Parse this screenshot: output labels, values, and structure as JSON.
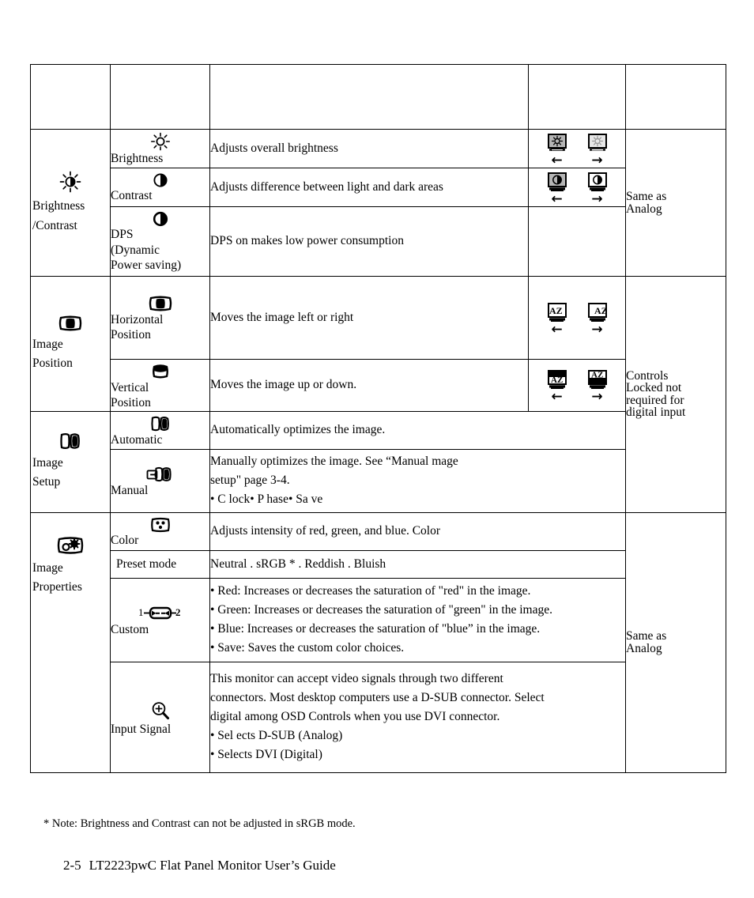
{
  "document": {
    "note": "* Note: Brightness and Contrast can not be adjusted in sRGB mode.",
    "footer_page": "2-5",
    "footer_title": "LT2223pwC Flat Panel Monitor User’s Guide"
  },
  "table": {
    "header_row": {
      "c1": "",
      "c2": "",
      "c3": "",
      "c4": "",
      "c5": ""
    },
    "groups": [
      {
        "category_label_line1": "Brightness",
        "category_label_line2": "/Contrast",
        "category_icon": "brightness-contrast-icon",
        "side_note_lines": [
          "Same as",
          "Analog"
        ],
        "rows": [
          {
            "sub_icon": "sun-icon",
            "sub_label": "Brightness",
            "description": "Adjusts overall brightness",
            "controls": [
              {
                "icon": "monitor-brightness-decrease-icon",
                "arrow": "←"
              },
              {
                "icon": "monitor-brightness-increase-icon",
                "arrow": "→"
              }
            ]
          },
          {
            "sub_icon": "contrast-half-circle-icon",
            "sub_label": "Contrast",
            "description": "Adjusts difference between light and dark areas",
            "controls": [
              {
                "icon": "monitor-contrast-decrease-icon",
                "arrow": "←"
              },
              {
                "icon": "monitor-contrast-increase-icon",
                "arrow": "→"
              }
            ]
          },
          {
            "sub_icon": "dps-half-circle-icon",
            "sub_label_line1": "DPS",
            "sub_label_line2": "(Dynamic",
            "sub_label_line3": "Power saving)",
            "description": "DPS on makes low power consumption",
            "controls": []
          }
        ]
      },
      {
        "category_label_line1": "Image",
        "category_label_line2": "Position",
        "category_icon": "horizontal-position-icon",
        "side_note_lines": [
          "Controls",
          "Locked not",
          "required for",
          "digital input"
        ],
        "rows": [
          {
            "sub_icon": "horizontal-position-icon",
            "sub_label_line1": "Horizontal",
            "sub_label_line2": "Position",
            "description": "Moves the image left or right",
            "controls": [
              {
                "icon": "monitor-move-left-icon",
                "arrow": "←"
              },
              {
                "icon": "monitor-move-right-icon",
                "arrow": "→"
              }
            ]
          },
          {
            "sub_icon": "vertical-position-icon",
            "sub_label_line1": "Vertical",
            "sub_label_line2": "Position",
            "description": "Moves the image up or down.",
            "controls": [
              {
                "icon": "monitor-move-down-icon",
                "arrow": "←"
              },
              {
                "icon": "monitor-move-up-icon",
                "arrow": "→"
              }
            ]
          }
        ]
      },
      {
        "category_label_line1": "Image",
        "category_label_line2": "Setup",
        "category_icon": "image-setup-icon",
        "rows": [
          {
            "sub_icon": "image-setup-icon",
            "sub_label": "Automatic",
            "description": "Automatically optimizes the image."
          },
          {
            "sub_icon": "manual-setup-icon",
            "sub_label": "Manual",
            "description_line1": "Manually optimizes the image. See “Manual mage",
            "description_line2": "setup\" page 3-4.",
            "description_line3": "•  C  lock•   P hase•   Sa ve"
          }
        ]
      },
      {
        "category_label_line1": "Image",
        "category_label_line2": "Properties",
        "category_icon": "image-properties-icon",
        "side_note_lines": [
          "Same as",
          "Analog"
        ],
        "rows": [
          {
            "sub_icon": "color-dots-icon",
            "sub_label": "Color",
            "description": "Adjusts intensity of red, green, and blue. Color"
          },
          {
            "sub_label": "Preset mode",
            "description": "Neutral         . sRGB        *        . Reddish              . Bluish"
          },
          {
            "sub_icon": "custom-1-2-icon",
            "sub_label": "Custom",
            "bullets": [
              "• Red: Increases or decreases the saturation of \"red\" in the image.",
              "• Green: Increases or decreases the saturation of \"green\" in the image.",
              "• Blue: Increases or decreases the saturation of \"blue” in the image.",
              "• Save: Saves the custom color choices."
            ]
          },
          {
            "sub_icon": "magnifier-plus-icon",
            "sub_label": "Input Signal",
            "description_line1": "This monitor can accept video signals through two different",
            "description_line2": "connectors. Most desktop computers use a D-SUB connector. Select",
            "description_line3": "digital among OSD Controls when you use DVI connector.",
            "bullets": [
              "•  Sel  ects D-SUB (Analog)",
              "•  Selects   DVI (Digital)"
            ]
          }
        ]
      }
    ]
  },
  "colors": {
    "ink": "#000000",
    "paper": "#ffffff",
    "icon_fill_light": "#b5b5b5",
    "icon_fill_dark": "#1a1a1a"
  }
}
